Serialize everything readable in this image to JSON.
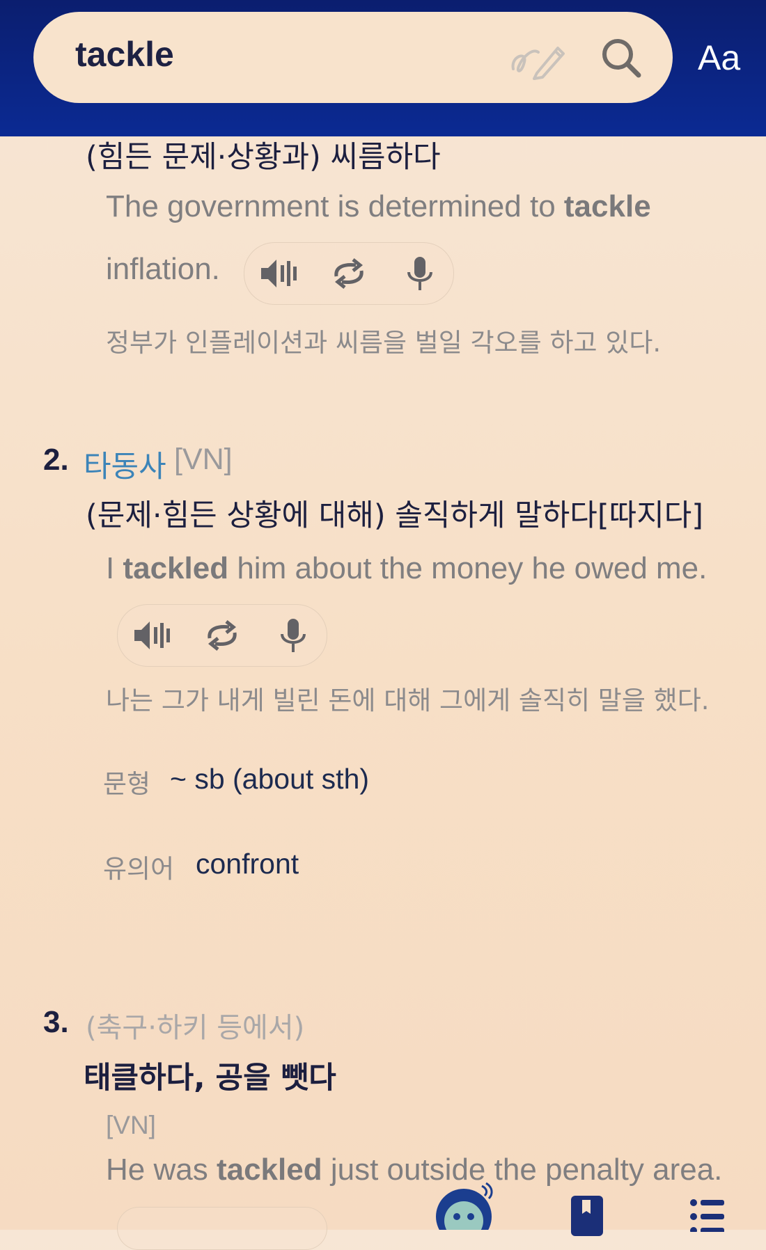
{
  "header": {
    "search_value": "tackle",
    "handwriting_icon": "handwriting-pen-icon",
    "search_icon": "search-icon",
    "font_size_label": "Aa"
  },
  "entries": {
    "sense1": {
      "meaning": "(힘든 문제·상황과) 씨름하다",
      "example_en_before": "The government is determined to ",
      "example_en_bold": "tackle",
      "example_en_after": "inflation.",
      "example_ko": "정부가 인플레이션과 씨름을 벌일 각오를 하고 있다."
    },
    "sense2": {
      "number": "2.",
      "pos": "타동사",
      "grammar": "[VN]",
      "meaning": "(문제·힘든 상황에 대해) 솔직하게 말하다[따지다]",
      "example_en_before": "I ",
      "example_en_bold": "tackled",
      "example_en_after": " him about the money he owed me.",
      "example_ko": "나는 그가 내게 빌린 돈에 대해 그에게 솔직히 말을 했다.",
      "pattern_label": "문형",
      "pattern_value": "~ sb (about sth)",
      "synonym_label": "유의어",
      "synonym_value": "confront"
    },
    "sense3": {
      "number": "3.",
      "domain": "(축구·하키 등에서)",
      "meaning": "태클하다, 공을 뺏다",
      "grammar": "[VN]",
      "example_en_before": "He was ",
      "example_en_bold": "tackled",
      "example_en_after": " just outside the penalty area."
    }
  },
  "controls": {
    "speaker_icon": "speaker-icon",
    "repeat_icon": "repeat-icon",
    "mic_icon": "microphone-icon"
  },
  "bottom_nav": {
    "mascot_icon": "mascot-icon",
    "bookmark_icon": "bookmark-icon",
    "list_icon": "list-icon"
  },
  "colors": {
    "header_bg": "#0b2285",
    "search_pill": "#f8e3cc",
    "page_bg": "#f7e2cc",
    "pos_blue": "#3c84b8",
    "text_dark": "#1c1f3f",
    "text_gray": "#7f7e80"
  }
}
